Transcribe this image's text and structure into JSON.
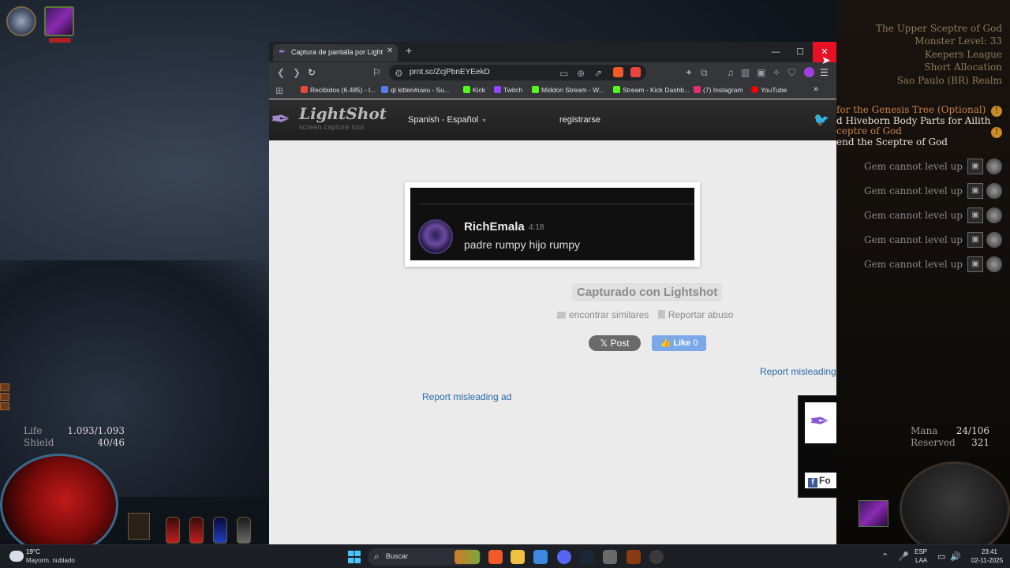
{
  "game": {
    "zone_info": [
      "The Upper Sceptre of God",
      "Monster Level: 33",
      "Keepers League",
      "Short Allocation",
      "Sao Paulo (BR) Realm"
    ],
    "quests": [
      {
        "text": "for the Genesis Tree (Optional)",
        "header": true
      },
      {
        "text": "d Hiveborn Body Parts for Ailith",
        "header": false
      },
      {
        "text": "ceptre of God",
        "header": true
      },
      {
        "text": "end the Sceptre of God",
        "header": false
      }
    ],
    "gem_messages": [
      "Gem cannot level up",
      "Gem cannot level up",
      "Gem cannot level up",
      "Gem cannot level up",
      "Gem cannot level up"
    ],
    "life_label": "Life",
    "life_value": "1.093/1.093",
    "shield_label": "Shield",
    "shield_value": "40/46",
    "mana_label": "Mana",
    "mana_value": "24/106",
    "reserved_label": "Reserved",
    "reserved_value": "321"
  },
  "browser": {
    "tab_title": "Captura de pantalla por Lightshot",
    "url": "prnt.sc/ZcjPbnEYEekD",
    "bookmarks": [
      "Recibidos (6.485) - l...",
      "qt kitten#uwu - Su...",
      "Kick",
      "Twitch",
      "Middori Stream - W...",
      "Stream - Kick Dashb...",
      "(7) Instagram",
      "YouTube"
    ],
    "bookmark_colors": [
      "#e84a3a",
      "#5a7ae8",
      "#53fc18",
      "#9146ff",
      "#53fc18",
      "#53fc18",
      "#e1306c",
      "#ff0000"
    ]
  },
  "lightshot": {
    "logo": "LightShot",
    "tagline": "screen capture tool",
    "language": "Spanish - Español",
    "register": "registrarse",
    "screenshot": {
      "username": "RichEmala",
      "time": "4:18",
      "message": "padre rumpy hijo rumpy"
    },
    "captured_label": "Capturado con Lightshot",
    "find_similar": "encontrar similares",
    "report_abuse": "Reportar abuso",
    "post_label": "Post",
    "like_label": "Like",
    "like_count": "0",
    "report_ad_1": "Report misleading a",
    "report_ad_2": "Report misleading ad",
    "ad_fb": "Fo"
  },
  "taskbar": {
    "temperature": "19°C",
    "weather": "Mayorm. nublado",
    "search_placeholder": "Buscar",
    "lang_1": "ESP",
    "lang_2": "LAA",
    "time": "23:41",
    "date": "02-11-2025"
  },
  "colors": {
    "accent_close": "#e81123",
    "link": "#2a6aa8",
    "like": "#7aa8e8"
  }
}
